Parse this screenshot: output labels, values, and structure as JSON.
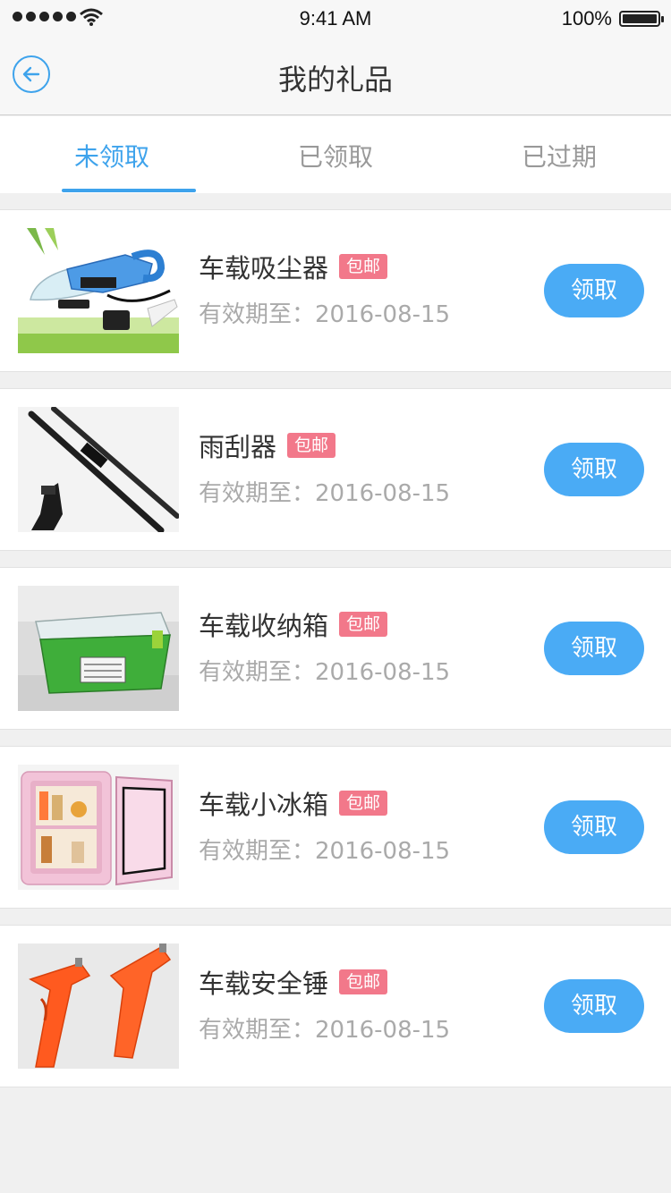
{
  "status_bar": {
    "time": "9:41 AM",
    "battery": "100%"
  },
  "nav": {
    "title": "我的礼品"
  },
  "tabs": [
    {
      "label": "未领取"
    },
    {
      "label": "已领取"
    },
    {
      "label": "已过期"
    }
  ],
  "colors": {
    "accent": "#3ea3ec",
    "button": "#4aabf5",
    "badge": "#f2788a"
  },
  "items": [
    {
      "name": "车载吸尘器",
      "badge": "包邮",
      "expiry": "有效期至：2016-08-15",
      "button": "领取",
      "image": "car-vacuum"
    },
    {
      "name": "雨刮器",
      "badge": "包邮",
      "expiry": "有效期至：2016-08-15",
      "button": "领取",
      "image": "wiper-blades"
    },
    {
      "name": "车载收纳箱",
      "badge": "包邮",
      "expiry": "有效期至：2016-08-15",
      "button": "领取",
      "image": "storage-box"
    },
    {
      "name": "车载小冰箱",
      "badge": "包邮",
      "expiry": "有效期至：2016-08-15",
      "button": "领取",
      "image": "mini-fridge"
    },
    {
      "name": "车载安全锤",
      "badge": "包邮",
      "expiry": "有效期至：2016-08-15",
      "button": "领取",
      "image": "safety-hammer"
    }
  ]
}
